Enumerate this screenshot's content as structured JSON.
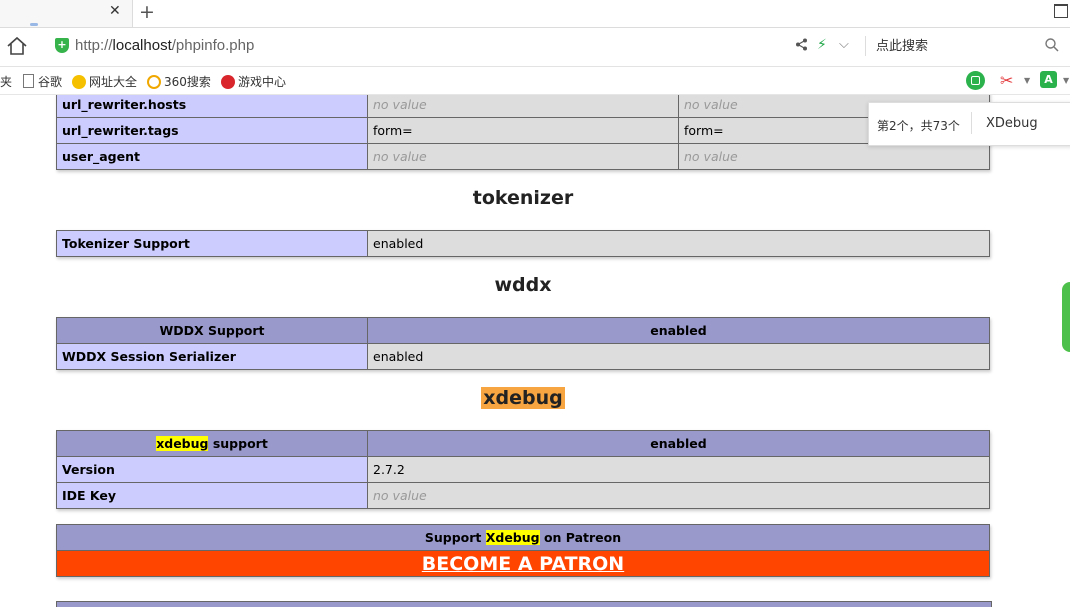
{
  "browser": {
    "tab_close": "✕",
    "new_tab": "+",
    "url_prefix": "http://",
    "url_host": "localhost",
    "url_path": "/phpinfo.php",
    "search_placeholder": "点此搜索",
    "bookmarks": [
      {
        "label": "夹"
      },
      {
        "label": "谷歌"
      },
      {
        "label": "网址大全"
      },
      {
        "label": "360搜索"
      },
      {
        "label": "游戏中心"
      }
    ],
    "find": {
      "count": "第2个，共73个",
      "term": "XDebug"
    }
  },
  "top_table": {
    "rows": [
      {
        "name": "url_rewriter.hosts",
        "local": "no value",
        "master": "no value"
      },
      {
        "name": "url_rewriter.tags",
        "local": "form=",
        "master": "form="
      },
      {
        "name": "user_agent",
        "local": "no value",
        "master": "no value"
      }
    ]
  },
  "tokenizer": {
    "title": "tokenizer",
    "rows": [
      {
        "name": "Tokenizer Support",
        "value": "enabled"
      }
    ]
  },
  "wddx": {
    "title": "wddx",
    "header": [
      "WDDX Support",
      "enabled"
    ],
    "rows": [
      {
        "name": "WDDX Session Serializer",
        "value": "enabled"
      }
    ]
  },
  "xdebug": {
    "title": "xdebug",
    "header_hl": "xdebug",
    "header_rest": " support",
    "header_value": "enabled",
    "rows": [
      {
        "name": "Version",
        "value": "2.7.2"
      },
      {
        "name": "IDE Key",
        "value": "no value"
      }
    ],
    "patron": {
      "prefix": "Support ",
      "highlight": "Xdebug",
      "suffix": " on Patreon",
      "link": "BECOME A PATRON"
    }
  },
  "colors": {
    "entry_bg": "#ccccff",
    "value_bg": "#dddddd",
    "header_bg": "#9999cc",
    "patron_bg": "#ff4500",
    "search_highlight": "#ffff00",
    "active_highlight": "#f7a541"
  },
  "icons": [
    "home-icon",
    "secure-shield-icon",
    "share-icon",
    "bolt-icon",
    "search-icon",
    "scissors-icon"
  ]
}
